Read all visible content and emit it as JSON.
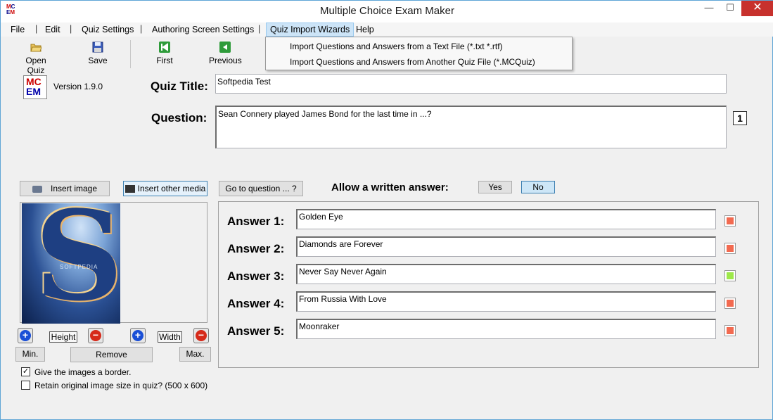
{
  "window": {
    "title": "Multiple Choice Exam Maker",
    "minimize": "—",
    "maximize": "☐",
    "close": "✕"
  },
  "menubar": {
    "file": "File",
    "edit": "Edit",
    "quiz_settings": "Quiz Settings",
    "authoring": "Authoring Screen Settings",
    "import_wizards": "Quiz Import Wizards",
    "help": "Help",
    "separator": "|"
  },
  "dropdown": {
    "item1": "Import Questions and Answers from a Text File (*.txt *.rtf)",
    "item2": "Import Questions and Answers from Another Quiz File (*.MCQuiz)"
  },
  "toolbar": {
    "open": "Open Quiz",
    "save": "Save",
    "first": "First",
    "previous": "Previous"
  },
  "app": {
    "logo_top": "MC",
    "logo_bottom": "EM",
    "version": "Version 1.9.0"
  },
  "quiz": {
    "title_label": "Quiz Title:",
    "title_value": "Softpedia Test",
    "question_label": "Question:",
    "question_value": "Sean Connery played James Bond for the last time in ...?",
    "question_number": "1"
  },
  "media": {
    "insert_image": "Insert image",
    "insert_other": "Insert other media",
    "height": "Height",
    "width": "Width",
    "min": "Min.",
    "remove": "Remove",
    "max": "Max.",
    "border_label": "Give the images a border.",
    "border_checked": true,
    "retain_label": "Retain original image size in quiz? (500 x 600)",
    "retain_checked": false,
    "image_watermark": "SOFTPEDIA"
  },
  "navigation": {
    "goto": "Go to question ... ?"
  },
  "written": {
    "label": "Allow a written answer:",
    "yes": "Yes",
    "no": "No"
  },
  "answers": [
    {
      "label": "Answer 1:",
      "value": "Golden Eye",
      "correct": false
    },
    {
      "label": "Answer 2:",
      "value": "Diamonds are Forever",
      "correct": false
    },
    {
      "label": "Answer 3:",
      "value": "Never Say Never Again",
      "correct": true
    },
    {
      "label": "Answer 4:",
      "value": "From Russia With Love",
      "correct": false
    },
    {
      "label": "Answer 5:",
      "value": "Moonraker",
      "correct": false
    }
  ],
  "colors": {
    "wrong": "#f26a50",
    "correct": "#9ee84a",
    "accent": "#3c7fb1",
    "plus": "#1a4fd6",
    "minus": "#d62a1a"
  }
}
